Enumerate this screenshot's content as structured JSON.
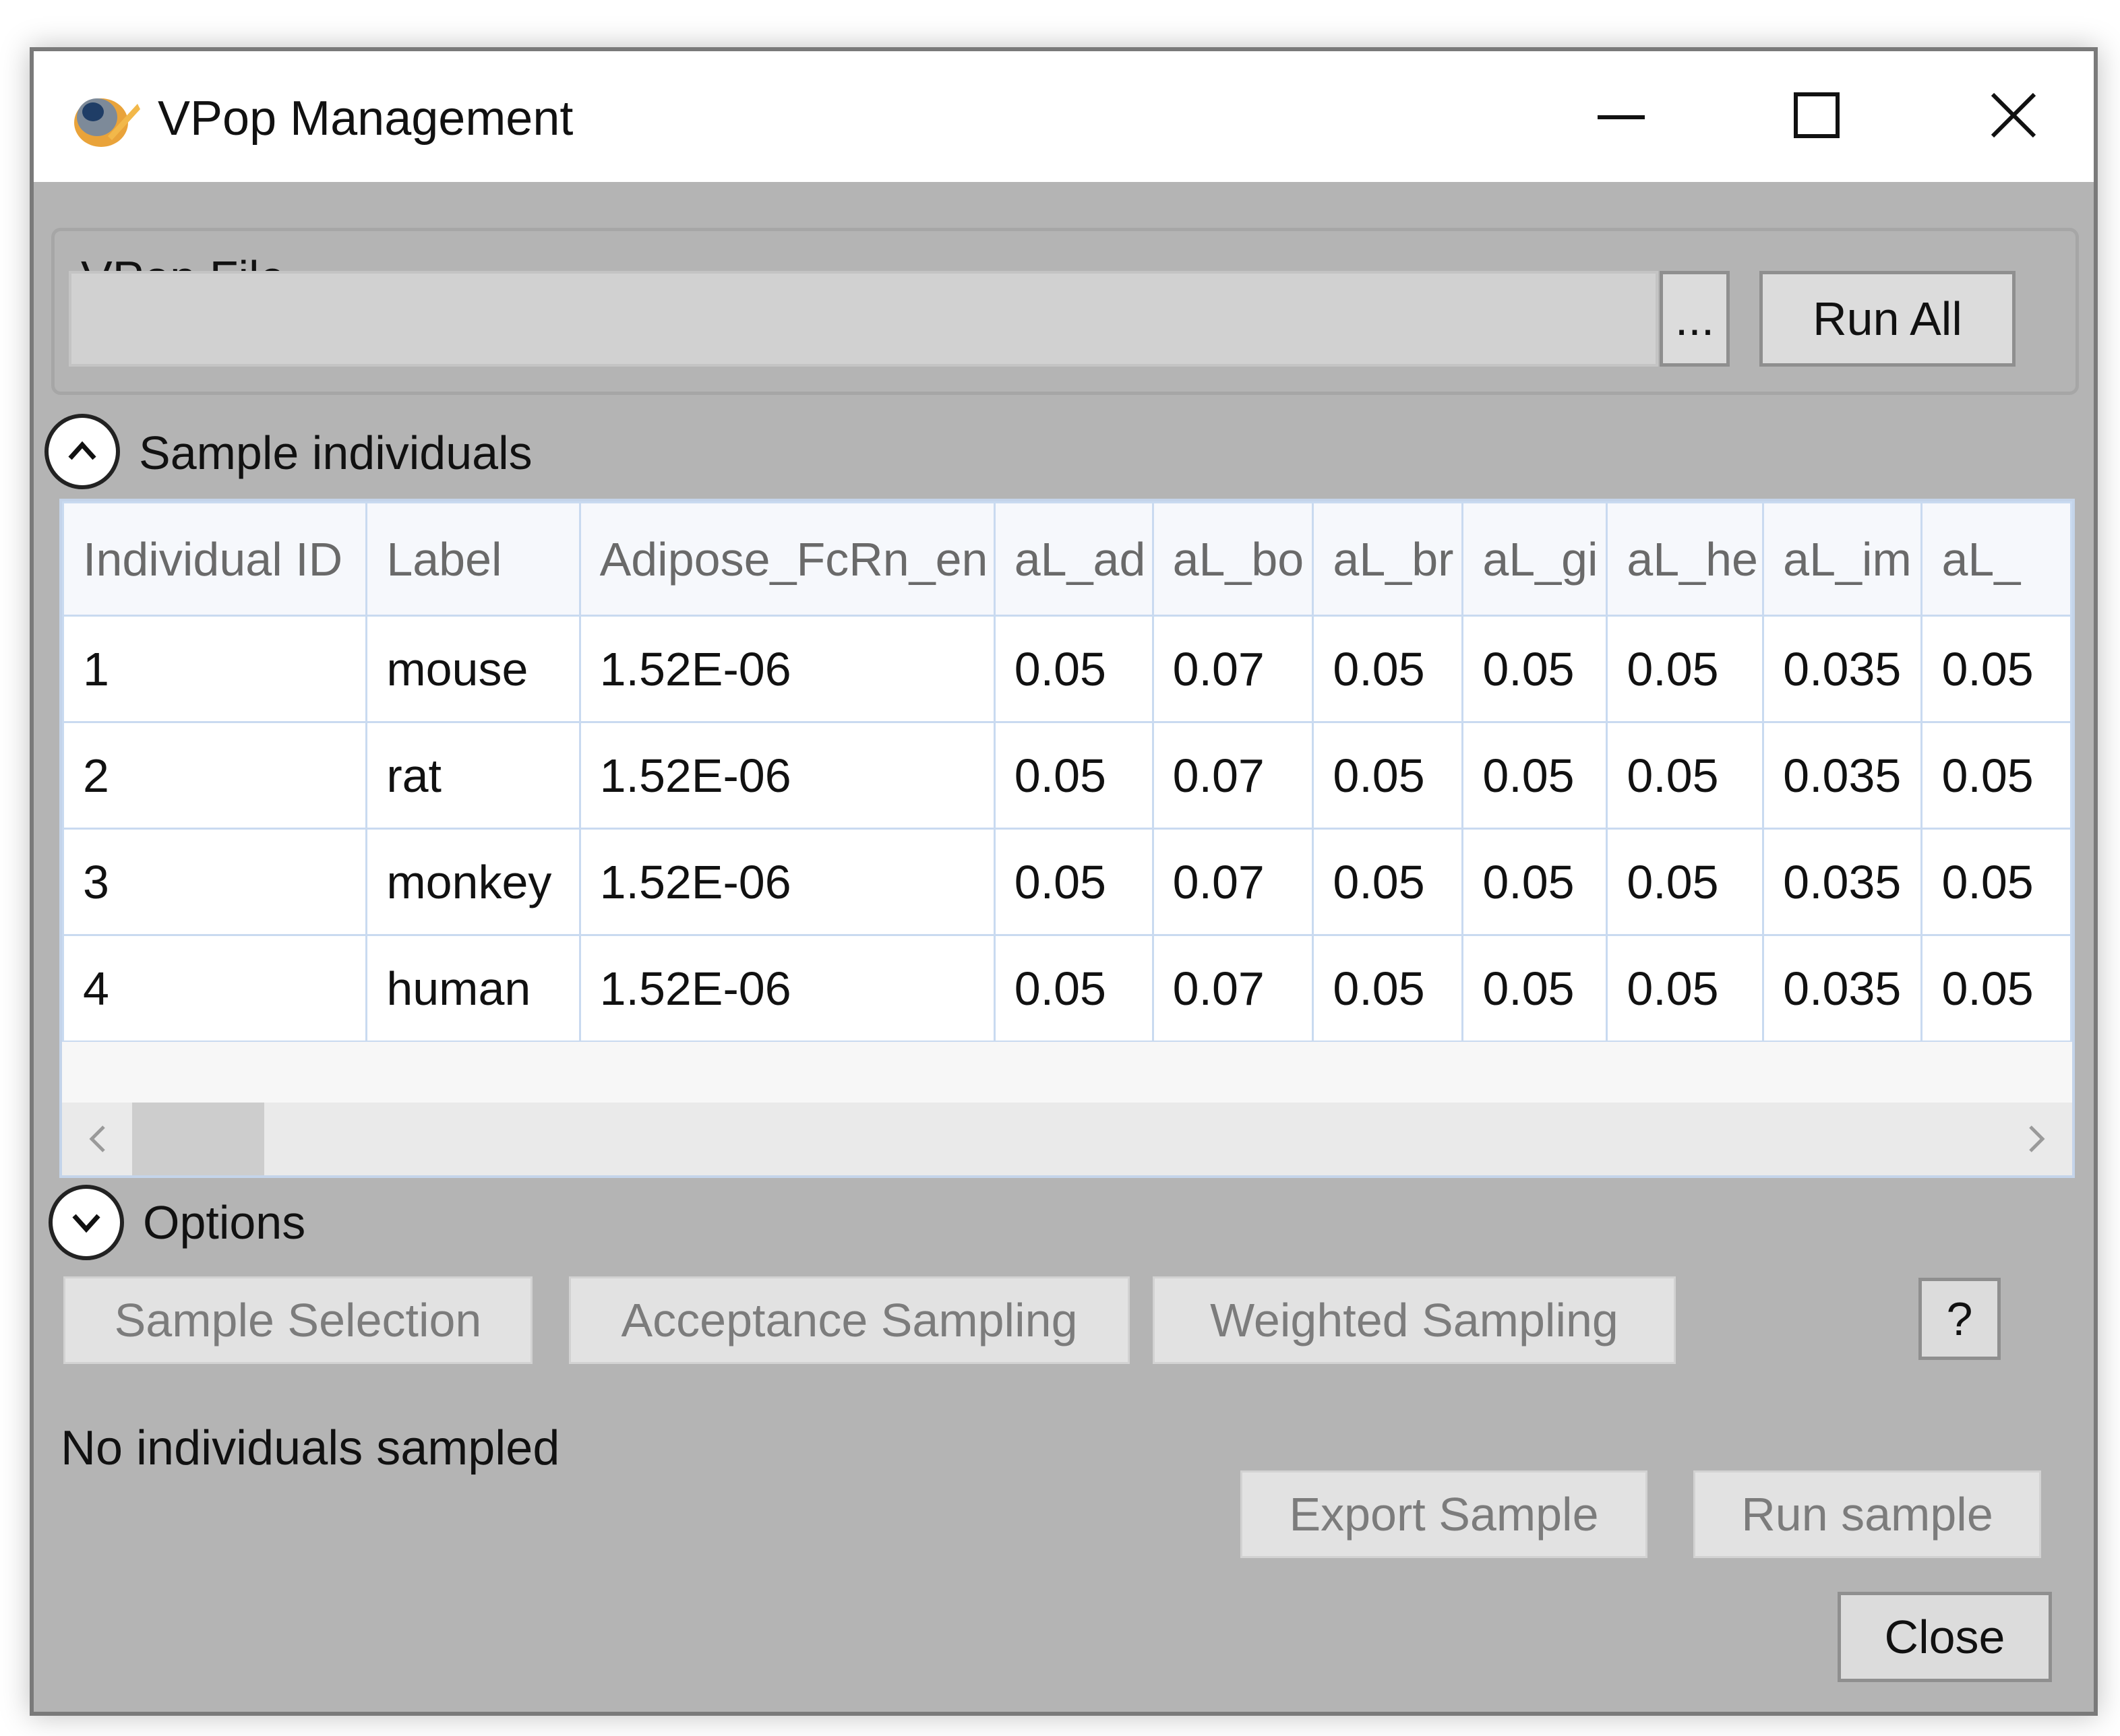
{
  "window": {
    "title": "VPop Management"
  },
  "vpop_file": {
    "group_label": "VPop File",
    "value": "",
    "browse_label": "...",
    "run_all_label": "Run All"
  },
  "sample_individuals": {
    "label": "Sample individuals",
    "columns": [
      "Individual ID",
      "Label",
      "Adipose_FcRn_en",
      "aL_ad",
      "aL_bo",
      "aL_br",
      "aL_gi",
      "aL_he",
      "aL_im",
      "aL_"
    ],
    "rows": [
      [
        "1",
        "mouse",
        "1.52E-06",
        "0.05",
        "0.07",
        "0.05",
        "0.05",
        "0.05",
        "0.035",
        "0.05"
      ],
      [
        "2",
        "rat",
        "1.52E-06",
        "0.05",
        "0.07",
        "0.05",
        "0.05",
        "0.05",
        "0.035",
        "0.05"
      ],
      [
        "3",
        "monkey",
        "1.52E-06",
        "0.05",
        "0.07",
        "0.05",
        "0.05",
        "0.05",
        "0.035",
        "0.05"
      ],
      [
        "4",
        "human",
        "1.52E-06",
        "0.05",
        "0.07",
        "0.05",
        "0.05",
        "0.05",
        "0.035",
        "0.05"
      ]
    ]
  },
  "options": {
    "label": "Options",
    "sample_selection_label": "Sample Selection",
    "acceptance_sampling_label": "Acceptance Sampling",
    "weighted_sampling_label": "Weighted Sampling",
    "help_label": "?"
  },
  "status": {
    "text": "No individuals sampled"
  },
  "footer": {
    "export_sample_label": "Export Sample",
    "run_sample_label": "Run sample",
    "close_label": "Close"
  },
  "icons": {
    "app": "vpop-app-icon",
    "minimize": "minimize-icon",
    "maximize": "maximize-icon",
    "close": "close-icon"
  }
}
